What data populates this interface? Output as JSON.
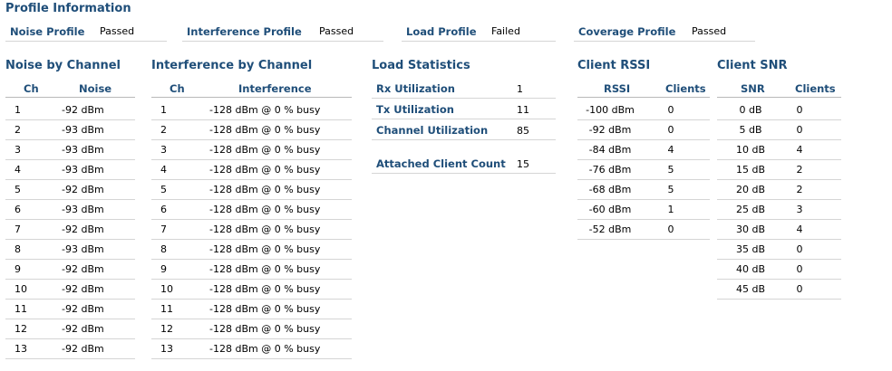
{
  "profile": {
    "title": "Profile Information",
    "items": [
      {
        "label": "Noise Profile",
        "value": "Passed"
      },
      {
        "label": "Interference Profile",
        "value": "Passed"
      },
      {
        "label": "Load Profile",
        "value": "Failed"
      },
      {
        "label": "Coverage Profile",
        "value": "Passed"
      }
    ]
  },
  "noise": {
    "title": "Noise by Channel",
    "headers": [
      "Ch",
      "Noise"
    ],
    "rows": [
      [
        "1",
        "-92 dBm"
      ],
      [
        "2",
        "-93 dBm"
      ],
      [
        "3",
        "-93 dBm"
      ],
      [
        "4",
        "-93 dBm"
      ],
      [
        "5",
        "-92 dBm"
      ],
      [
        "6",
        "-93 dBm"
      ],
      [
        "7",
        "-92 dBm"
      ],
      [
        "8",
        "-93 dBm"
      ],
      [
        "9",
        "-92 dBm"
      ],
      [
        "10",
        "-92 dBm"
      ],
      [
        "11",
        "-92 dBm"
      ],
      [
        "12",
        "-92 dBm"
      ],
      [
        "13",
        "-92 dBm"
      ]
    ]
  },
  "interference": {
    "title": "Interference by Channel",
    "headers": [
      "Ch",
      "Interference"
    ],
    "rows": [
      [
        "1",
        "-128 dBm @ 0 % busy"
      ],
      [
        "2",
        "-128 dBm @ 0 % busy"
      ],
      [
        "3",
        "-128 dBm @ 0 % busy"
      ],
      [
        "4",
        "-128 dBm @ 0 % busy"
      ],
      [
        "5",
        "-128 dBm @ 0 % busy"
      ],
      [
        "6",
        "-128 dBm @ 0 % busy"
      ],
      [
        "7",
        "-128 dBm @ 0 % busy"
      ],
      [
        "8",
        "-128 dBm @ 0 % busy"
      ],
      [
        "9",
        "-128 dBm @ 0 % busy"
      ],
      [
        "10",
        "-128 dBm @ 0 % busy"
      ],
      [
        "11",
        "-128 dBm @ 0 % busy"
      ],
      [
        "12",
        "-128 dBm @ 0 % busy"
      ],
      [
        "13",
        "-128 dBm @ 0 % busy"
      ]
    ]
  },
  "load": {
    "title": "Load Statistics",
    "rows": [
      {
        "label": "Rx Utilization",
        "value": "1"
      },
      {
        "label": "Tx Utilization",
        "value": "11"
      },
      {
        "label": "Channel Utilization",
        "value": "85"
      }
    ],
    "attached": {
      "label": "Attached Client Count",
      "value": "15"
    }
  },
  "rssi": {
    "title": "Client RSSI",
    "headers": [
      "RSSI",
      "Clients"
    ],
    "rows": [
      [
        "-100 dBm",
        "0"
      ],
      [
        "-92 dBm",
        "0"
      ],
      [
        "-84 dBm",
        "4"
      ],
      [
        "-76 dBm",
        "5"
      ],
      [
        "-68 dBm",
        "5"
      ],
      [
        "-60 dBm",
        "1"
      ],
      [
        "-52 dBm",
        "0"
      ]
    ]
  },
  "snr": {
    "title": "Client SNR",
    "headers": [
      "SNR",
      "Clients"
    ],
    "rows": [
      [
        "0 dB",
        "0"
      ],
      [
        "5 dB",
        "0"
      ],
      [
        "10 dB",
        "4"
      ],
      [
        "15 dB",
        "2"
      ],
      [
        "20 dB",
        "2"
      ],
      [
        "25 dB",
        "3"
      ],
      [
        "30 dB",
        "4"
      ],
      [
        "35 dB",
        "0"
      ],
      [
        "40 dB",
        "0"
      ],
      [
        "45 dB",
        "0"
      ]
    ]
  }
}
